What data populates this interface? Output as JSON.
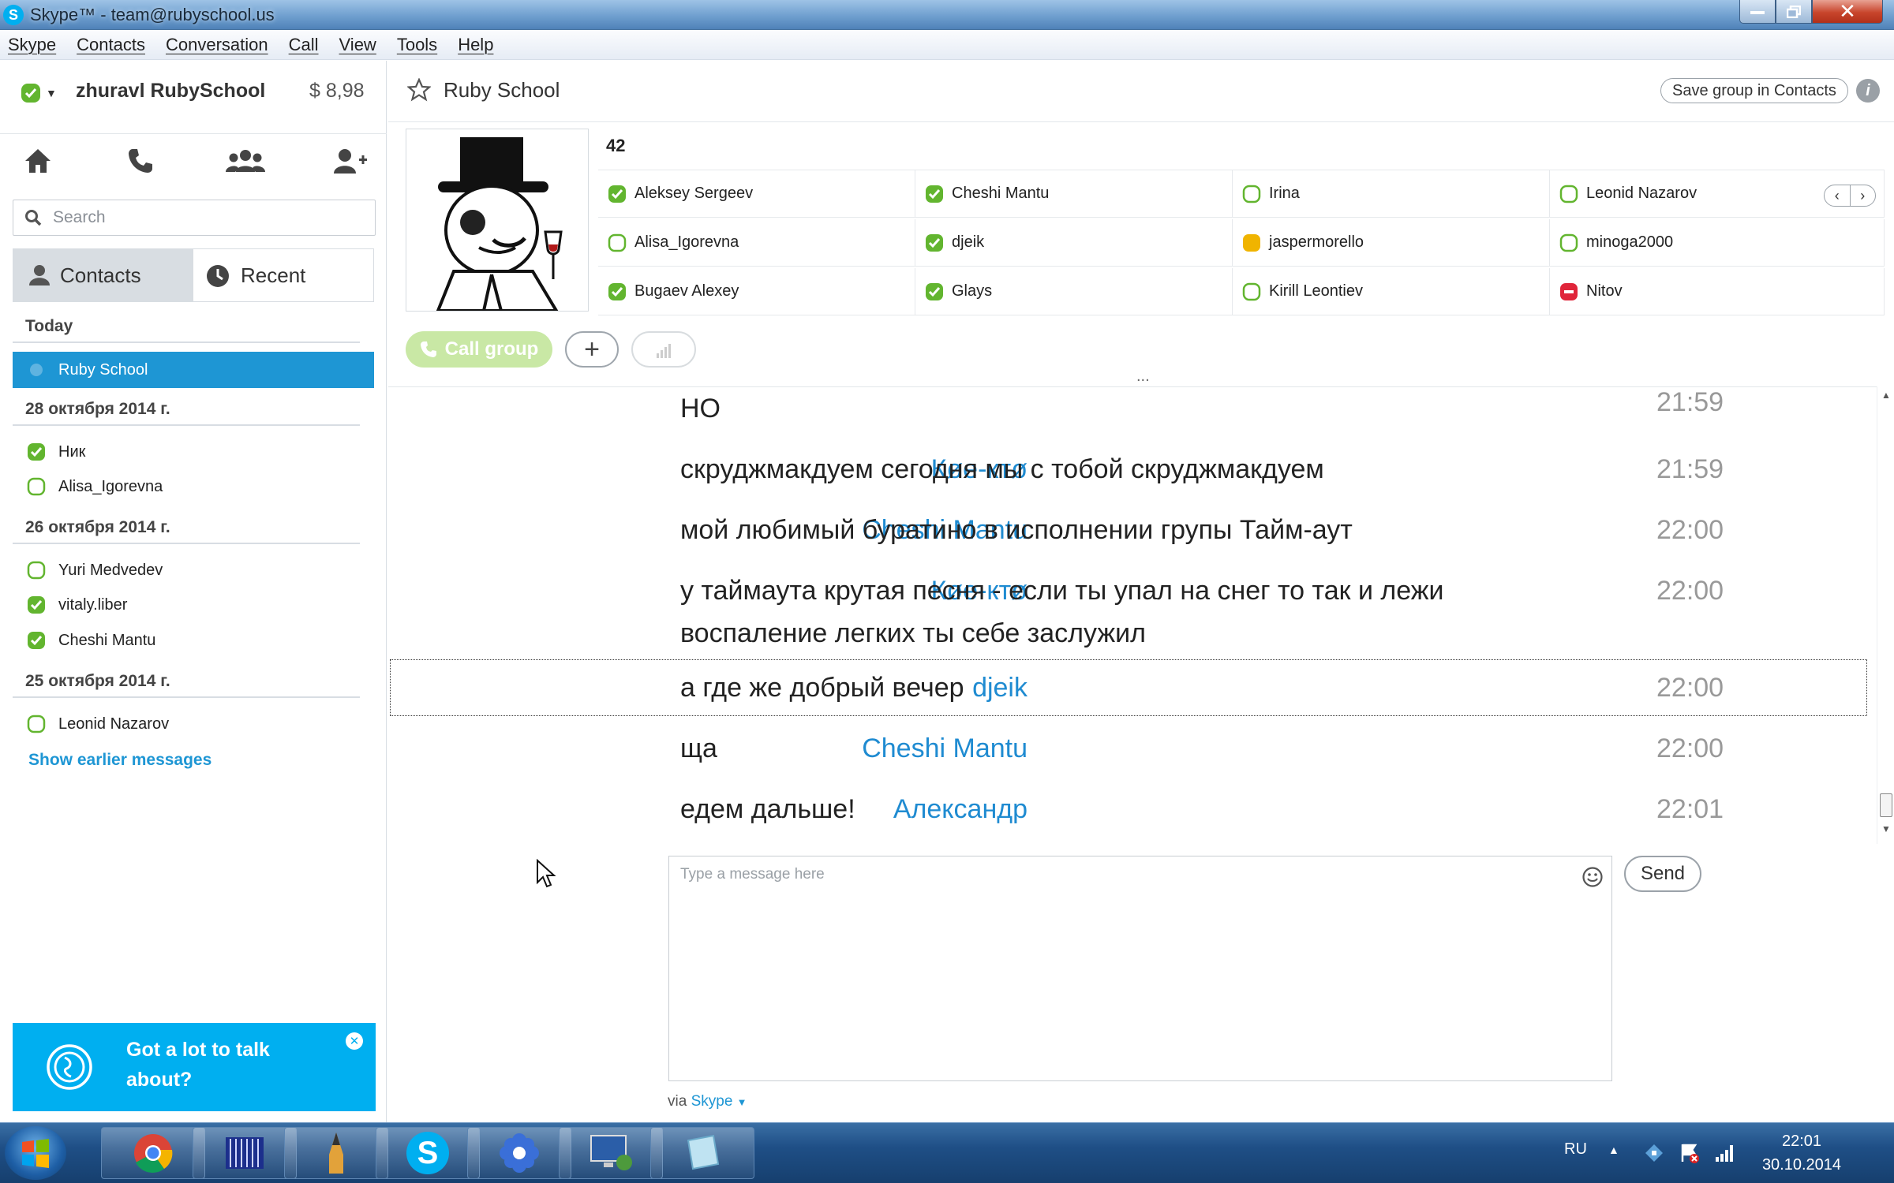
{
  "window": {
    "title": "Skype™ - team@rubyschool.us"
  },
  "menu": [
    "Skype",
    "Contacts",
    "Conversation",
    "Call",
    "View",
    "Tools",
    "Help"
  ],
  "account": {
    "name": "zhuravl RubySchool",
    "balance": "$ 8,98"
  },
  "search": {
    "placeholder": "Search"
  },
  "tabs": {
    "contacts": "Contacts",
    "recent": "Recent"
  },
  "recent": {
    "today": "Today",
    "today_items": [
      {
        "name": "Ruby School"
      }
    ],
    "d28": "28 октября 2014 г.",
    "d28_items": [
      {
        "name": "Ник",
        "status": "online"
      },
      {
        "name": "Alisa_Igorevna",
        "status": "offline"
      }
    ],
    "d26": "26 октября 2014 г.",
    "d26_items": [
      {
        "name": "Yuri Medvedev",
        "status": "offline"
      },
      {
        "name": "vitaly.liber",
        "status": "online"
      },
      {
        "name": "Cheshi Mantu",
        "status": "online"
      }
    ],
    "d25": "25 октября 2014 г.",
    "d25_items": [
      {
        "name": "Leonid Nazarov",
        "status": "offline"
      }
    ],
    "show_earlier": "Show earlier messages"
  },
  "promo": {
    "text_line1": "Got a lot to talk",
    "text_line2": "about?"
  },
  "group": {
    "name": "Ruby School",
    "save_label": "Save group in Contacts",
    "count": "42",
    "members": [
      {
        "name": "Aleksey Sergeev",
        "status": "online"
      },
      {
        "name": "Cheshi Mantu",
        "status": "online"
      },
      {
        "name": "Irina",
        "status": "offline"
      },
      {
        "name": "Leonid Nazarov",
        "status": "offline"
      },
      {
        "name": "Alisa_Igorevna",
        "status": "offline"
      },
      {
        "name": "djeik",
        "status": "online"
      },
      {
        "name": "jaspermorello",
        "status": "away"
      },
      {
        "name": "minoga2000",
        "status": "offline"
      },
      {
        "name": "Bugaev Alexey",
        "status": "online"
      },
      {
        "name": "Glays",
        "status": "online"
      },
      {
        "name": "Kirill Leontiev",
        "status": "offline"
      },
      {
        "name": "Nitov",
        "status": "dnd"
      }
    ]
  },
  "call": {
    "call_group": "Call group",
    "more": "..."
  },
  "messages": [
    {
      "sender": "",
      "text": "НО",
      "time": "21:59"
    },
    {
      "sender": "Кøе-ктø",
      "text": "скруджмакдуем сегодня мы с тобой скруджмакдуем",
      "time": "21:59"
    },
    {
      "sender": "Cheshi Mantu",
      "text": "мой любимый буратино в исполнении групы Тайм-аут",
      "time": "22:00"
    },
    {
      "sender": "Кøе-ктø",
      "text": "у таймаута крутая песня - если ты упал на снег то так и лежи",
      "text2": "воспаление легких ты себе заслужил",
      "time": "22:00"
    },
    {
      "sender": "djeik",
      "text": "а где же добрый вечер",
      "time": "22:00"
    },
    {
      "sender": "Cheshi Mantu",
      "text": "ща",
      "time": "22:00"
    },
    {
      "sender": "Александр",
      "text": "едем дальше!",
      "time": "22:01"
    }
  ],
  "composer": {
    "placeholder": "Type a message here",
    "send": "Send",
    "via_prefix": "via",
    "via_app": "Skype"
  },
  "taskbar": {
    "lang": "RU",
    "time": "22:01",
    "date": "30.10.2014"
  },
  "colors": {
    "accent": "#00aff0",
    "selected": "#1e96d4",
    "sender": "#1f8bd1",
    "online": "#62b52f",
    "away": "#f0b400",
    "dnd": "#e0253a"
  }
}
